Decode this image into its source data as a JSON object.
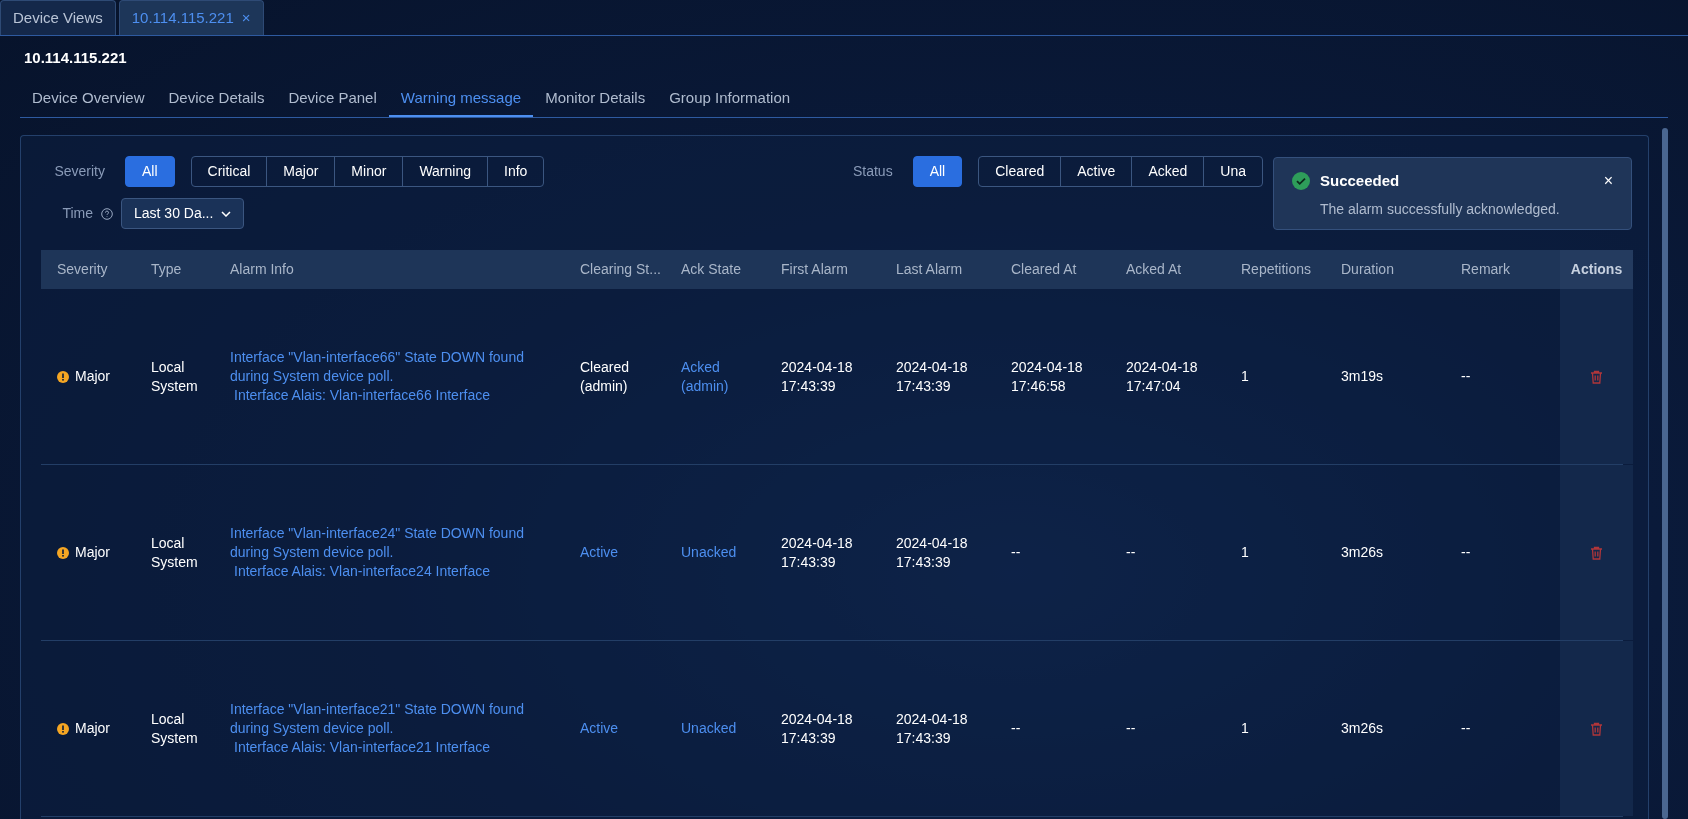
{
  "top_tabs": [
    {
      "label": "Device Views",
      "selected": false
    },
    {
      "label": "10.114.115.221",
      "selected": true,
      "close": "×"
    }
  ],
  "device_title": "10.114.115.221",
  "tabs": [
    {
      "label": "Device Overview",
      "selected": false
    },
    {
      "label": "Device Details",
      "selected": false
    },
    {
      "label": "Device Panel",
      "selected": false
    },
    {
      "label": "Warning message",
      "selected": true
    },
    {
      "label": "Monitor Details",
      "selected": false
    },
    {
      "label": "Group Information",
      "selected": false
    }
  ],
  "severity_filter": {
    "label": "Severity",
    "options": [
      {
        "label": "All",
        "selected": true
      },
      {
        "label": "Critical",
        "selected": false
      },
      {
        "label": "Major",
        "selected": false
      },
      {
        "label": "Minor",
        "selected": false
      },
      {
        "label": "Warning",
        "selected": false
      },
      {
        "label": "Info",
        "selected": false
      }
    ]
  },
  "time_filter": {
    "label": "Time",
    "value": "Last 30 Da..."
  },
  "status_filter": {
    "label": "Status",
    "options": [
      {
        "label": "All",
        "selected": true
      },
      {
        "label": "Cleared",
        "selected": false
      },
      {
        "label": "Active",
        "selected": false
      },
      {
        "label": "Acked",
        "selected": false
      },
      {
        "label": "Una",
        "selected": false
      }
    ]
  },
  "toast": {
    "title": "Succeeded",
    "message": "The alarm successfully acknowledged.",
    "close": "×"
  },
  "table": {
    "columns": [
      "Severity",
      "Type",
      "Alarm Info",
      "Clearing St...",
      "Ack State",
      "First Alarm",
      "Last Alarm",
      "Cleared At",
      "Acked At",
      "Repetitions",
      "Duration",
      "Remark",
      "Actions"
    ],
    "rows": [
      {
        "cells": [
          {
            "kind": "severity",
            "text": "Major",
            "color": "#f5a623"
          },
          {
            "kind": "text",
            "text": "Local System"
          },
          {
            "kind": "link",
            "lines": [
              "Interface \"Vlan-interface66\" State DOWN found during System device poll.",
              "Interface Alais: Vlan-interface66 Interface"
            ]
          },
          {
            "kind": "text",
            "text": "Cleared (admin)"
          },
          {
            "kind": "link",
            "text": "Acked (admin)"
          },
          {
            "kind": "text",
            "text": "2024-04-18 17:43:39"
          },
          {
            "kind": "text",
            "text": "2024-04-18 17:43:39"
          },
          {
            "kind": "text",
            "text": "2024-04-18 17:46:58"
          },
          {
            "kind": "text",
            "text": "2024-04-18 17:47:04"
          },
          {
            "kind": "text",
            "text": "1"
          },
          {
            "kind": "text",
            "text": "3m19s"
          },
          {
            "kind": "text",
            "text": "--"
          },
          {
            "kind": "delete"
          }
        ]
      },
      {
        "cells": [
          {
            "kind": "severity",
            "text": "Major",
            "color": "#f5a623"
          },
          {
            "kind": "text",
            "text": "Local System"
          },
          {
            "kind": "link",
            "lines": [
              "Interface \"Vlan-interface24\" State DOWN found during System device poll.",
              "Interface Alais: Vlan-interface24 Interface"
            ]
          },
          {
            "kind": "link",
            "text": "Active"
          },
          {
            "kind": "link",
            "text": "Unacked"
          },
          {
            "kind": "text",
            "text": "2024-04-18 17:43:39"
          },
          {
            "kind": "text",
            "text": "2024-04-18 17:43:39"
          },
          {
            "kind": "text",
            "text": "--"
          },
          {
            "kind": "text",
            "text": "--"
          },
          {
            "kind": "text",
            "text": "1"
          },
          {
            "kind": "text",
            "text": "3m26s"
          },
          {
            "kind": "text",
            "text": "--"
          },
          {
            "kind": "delete"
          }
        ]
      },
      {
        "cells": [
          {
            "kind": "severity",
            "text": "Major",
            "color": "#f5a623"
          },
          {
            "kind": "text",
            "text": "Local System"
          },
          {
            "kind": "link",
            "lines": [
              "Interface \"Vlan-interface21\" State DOWN found during System device poll.",
              "Interface Alais: Vlan-interface21 Interface"
            ]
          },
          {
            "kind": "link",
            "text": "Active"
          },
          {
            "kind": "link",
            "text": "Unacked"
          },
          {
            "kind": "text",
            "text": "2024-04-18 17:43:39"
          },
          {
            "kind": "text",
            "text": "2024-04-18 17:43:39"
          },
          {
            "kind": "text",
            "text": "--"
          },
          {
            "kind": "text",
            "text": "--"
          },
          {
            "kind": "text",
            "text": "1"
          },
          {
            "kind": "text",
            "text": "3m26s"
          },
          {
            "kind": "text",
            "text": "--"
          },
          {
            "kind": "delete"
          }
        ]
      }
    ]
  }
}
